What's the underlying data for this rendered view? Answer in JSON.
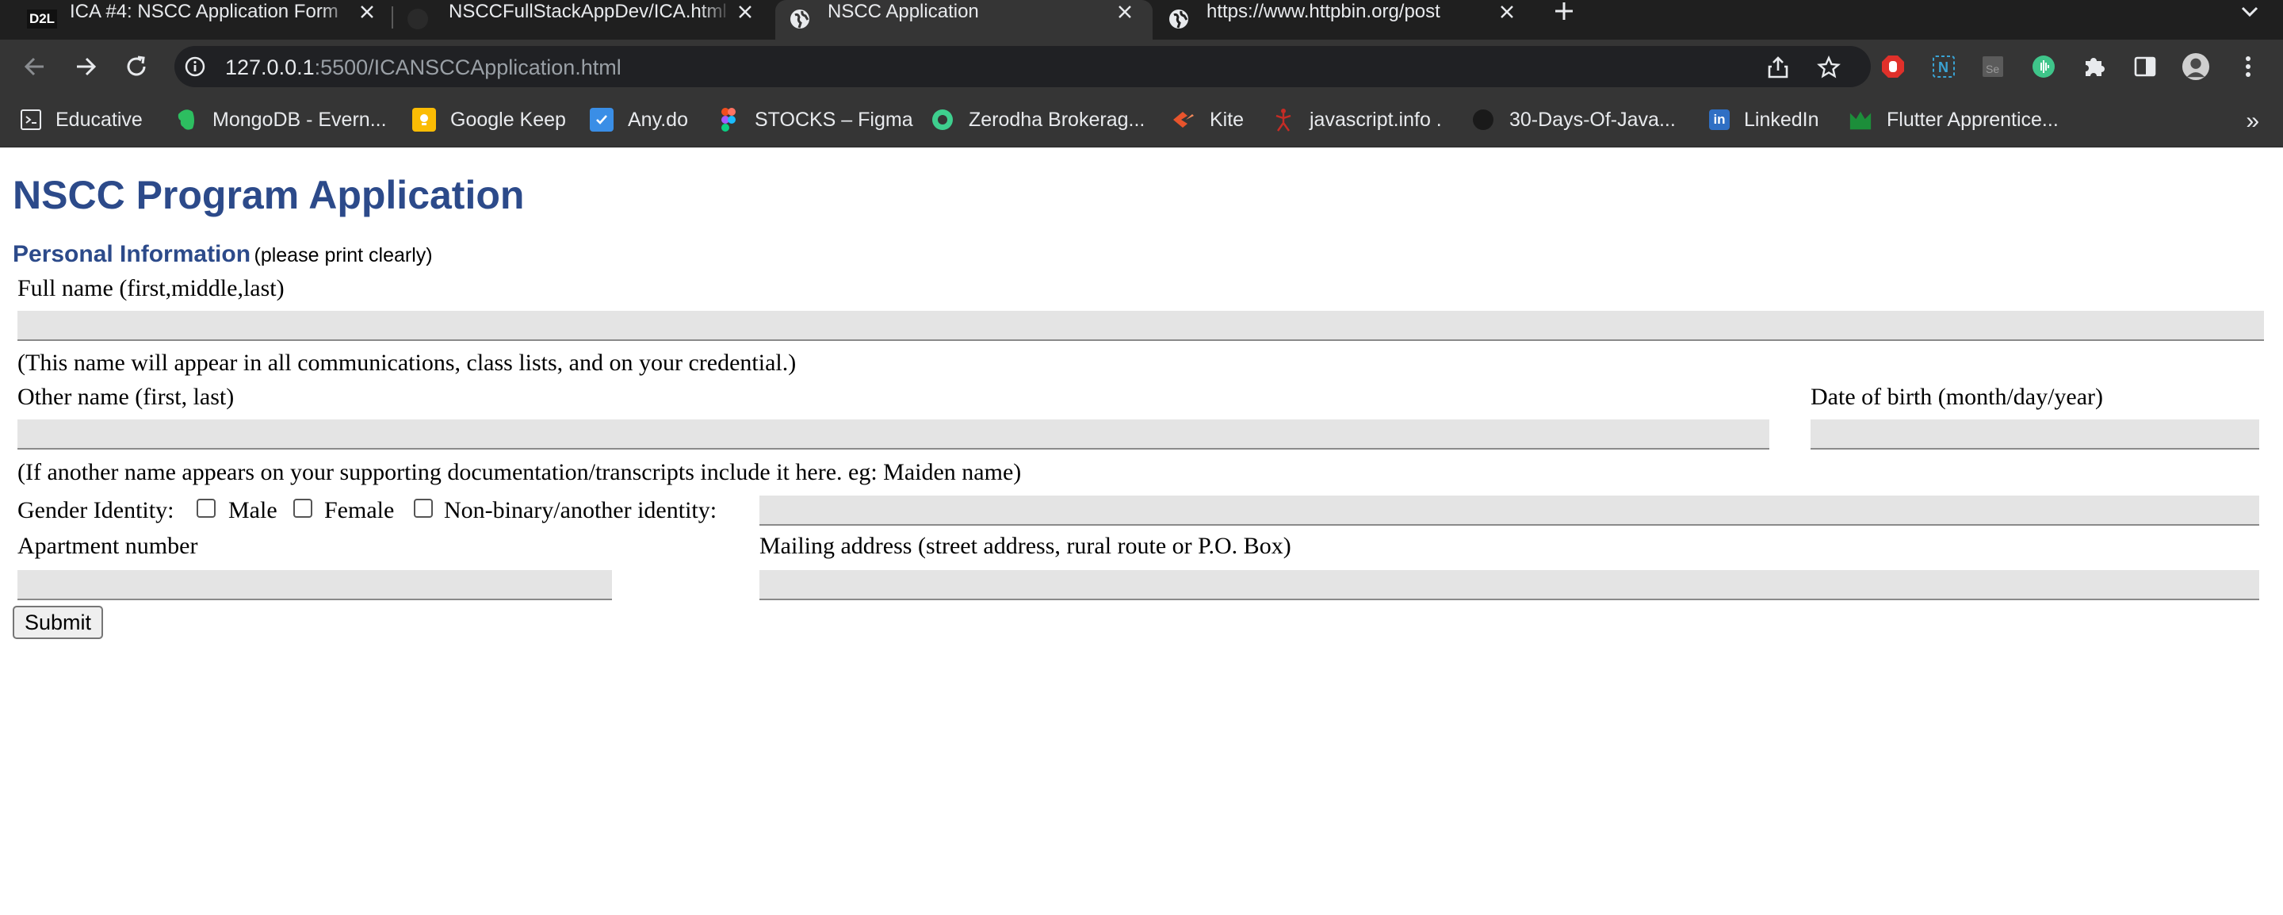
{
  "browser": {
    "tabs": [
      {
        "title": "ICA #4: NSCC Application Form",
        "favicon": "d2l-icon",
        "active": false
      },
      {
        "title": "NSCCFullStackAppDev/ICA.html",
        "favicon": "github-icon",
        "active": false
      },
      {
        "title": "NSCC Application",
        "favicon": "globe-icon",
        "active": true
      },
      {
        "title": "https://www.httpbin.org/post",
        "favicon": "globe-icon",
        "active": false
      }
    ],
    "favicon_text": "D2L",
    "url_host": "127.0.0.1",
    "url_rest": ":5500/ICANSCCApplication.html",
    "bookmarks": [
      {
        "label": "Educative",
        "icon": "educative-icon",
        "color": "#ffffff"
      },
      {
        "label": "MongoDB - Evern...",
        "icon": "evernote-icon",
        "color": "#2dbe60"
      },
      {
        "label": "Google Keep",
        "icon": "keep-icon",
        "color": "#fbbc04"
      },
      {
        "label": "Any.do",
        "icon": "anydo-icon",
        "color": "#3a8ee6"
      },
      {
        "label": "STOCKS – Figma",
        "icon": "figma-icon",
        "color": "#f24e1e"
      },
      {
        "label": "Zerodha Brokerag...",
        "icon": "zerodha-icon",
        "color": "#3ecf8e"
      },
      {
        "label": "Kite",
        "icon": "kite-icon",
        "color": "#e8542c"
      },
      {
        "label": "javascript.info .",
        "icon": "javascript-info-icon",
        "color": "#c72c25"
      },
      {
        "label": "30-Days-Of-Java...",
        "icon": "github-icon",
        "color": "#111111"
      },
      {
        "label": "LinkedIn",
        "icon": "linkedin-icon",
        "color": "#2f6fc4"
      },
      {
        "label": "Flutter Apprentice...",
        "icon": "raywenderlich-icon",
        "color": "#1c8e3a"
      }
    ],
    "bookmarks_more": "»"
  },
  "form": {
    "title": "NSCC Program Application",
    "section_heading": "Personal Information",
    "section_note": "(please print clearly)",
    "full_name_label": "Full name (first,middle,last)",
    "full_name_value": "",
    "full_name_help": "(This name will appear in all communications, class lists, and on your credential.)",
    "other_name_label": "Other name (first, last)",
    "other_name_value": "",
    "dob_label": "Date of birth (month/day/year)",
    "dob_value": "",
    "other_name_help": "(If another name appears on your supporting documentation/transcripts include it here. eg: Maiden name)",
    "gender_label": "Gender Identity:",
    "gender_options": [
      "Male",
      "Female",
      "Non-binary/another identity:"
    ],
    "gender_other_value": "",
    "apartment_label": "Apartment number",
    "apartment_value": "",
    "mailing_label": "Mailing address (street address, rural route or P.O. Box)",
    "mailing_value": "",
    "submit_label": "Submit"
  }
}
